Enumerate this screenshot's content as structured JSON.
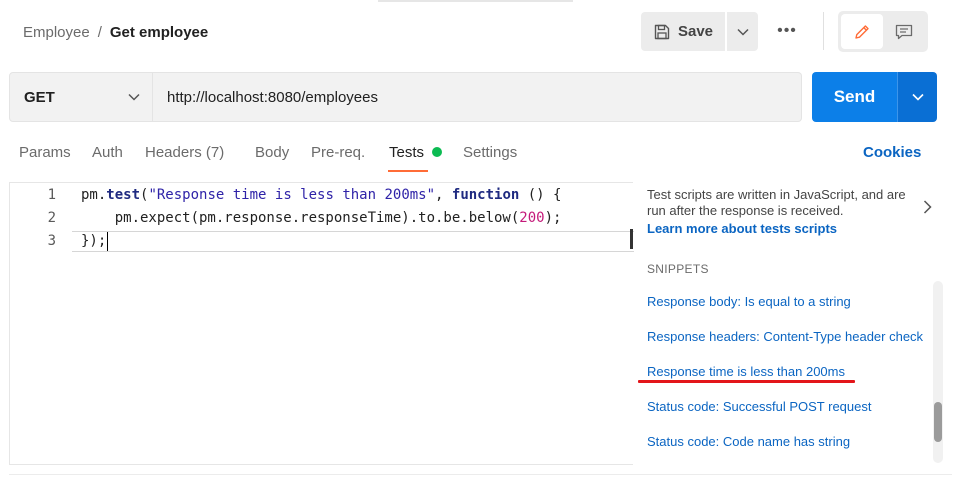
{
  "breadcrumb": {
    "parent": "Employee",
    "separator": "/",
    "current": "Get employee"
  },
  "toolbar": {
    "save_label": "Save",
    "more_label": "•••"
  },
  "request": {
    "method": "GET",
    "url": "http://localhost:8080/employees",
    "send_label": "Send"
  },
  "tabs": [
    {
      "label": "Params"
    },
    {
      "label": "Auth"
    },
    {
      "label": "Headers (7)"
    },
    {
      "label": "Body"
    },
    {
      "label": "Pre-req."
    },
    {
      "label": "Tests",
      "active": true,
      "indicator": "green-dot"
    },
    {
      "label": "Settings"
    }
  ],
  "cookies_label": "Cookies",
  "editor": {
    "line_numbers": [
      "1",
      "2",
      "3"
    ],
    "lines": [
      "pm.test(\"Response time is less than 200ms\", function () {",
      "    pm.expect(pm.response.responseTime).to.be.below(200);",
      "});"
    ]
  },
  "side_panel": {
    "info": "Test scripts are written in JavaScript, and are run after the response is received.",
    "learn_link": "Learn more about tests scripts",
    "snippets_heading": "SNIPPETS",
    "snippets": [
      "Response body: Is equal to a string",
      "Response headers: Content-Type header check",
      "Response time is less than 200ms",
      "Status code: Successful POST request",
      "Status code: Code name has string"
    ],
    "highlighted_snippet_index": 2
  },
  "colors": {
    "send": "#0c7fe8",
    "link": "#0b65c2",
    "active_tab_underline": "#ff6c37",
    "tests_dot": "#0cbb52",
    "highlight_underline": "#e3151a"
  }
}
